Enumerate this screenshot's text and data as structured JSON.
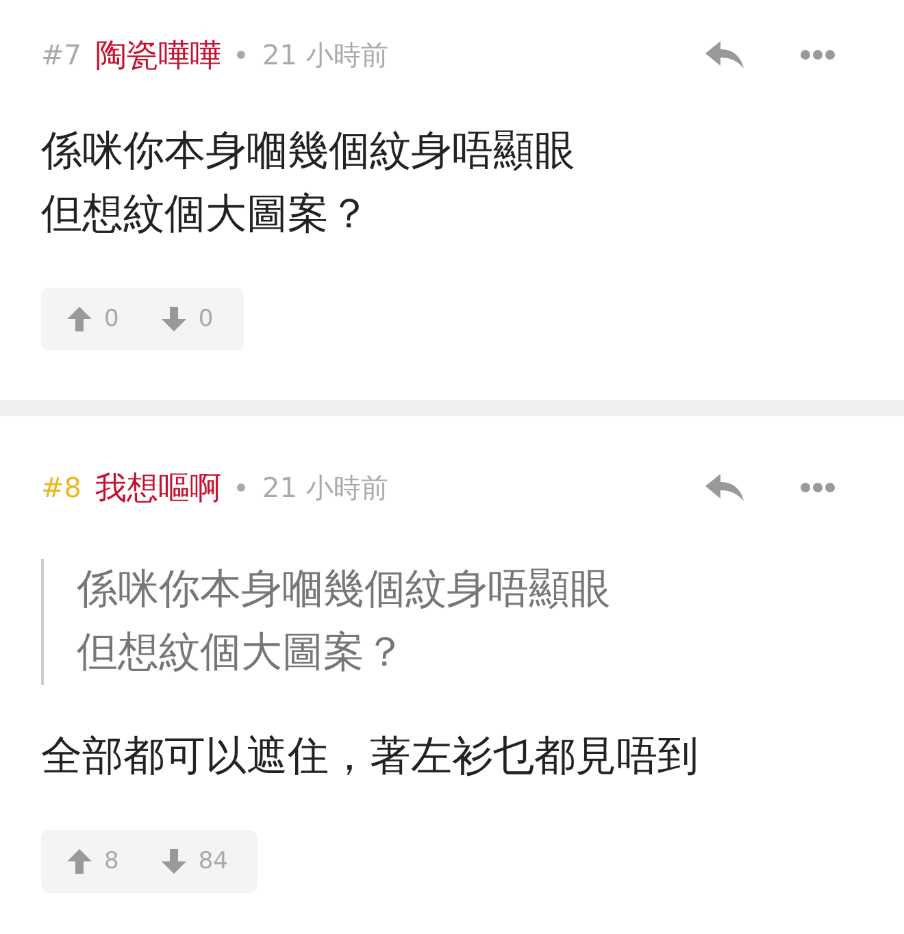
{
  "comments": [
    {
      "number": "#7",
      "color": "#aaaaaa",
      "author": "陶瓷嘩嘩",
      "time": "21 小時前",
      "body": [
        {
          "kind": "text",
          "lines": [
            "係咪你本身嗰幾個紋身唔顯眼",
            "但想紋個大圖案？"
          ]
        }
      ],
      "upvotes": "0",
      "downvotes": "0"
    },
    {
      "number": "#8",
      "color": "#e8b820",
      "author": "我想嘔啊",
      "time": "21 小時前",
      "body": [
        {
          "kind": "quote",
          "lines": [
            "係咪你本身嗰幾個紋身唔顯眼",
            "但想紋個大圖案？"
          ]
        },
        {
          "kind": "text",
          "lines": [
            "全部都可以遮住，著左衫乜都見唔到"
          ]
        }
      ],
      "upvotes": "8",
      "downvotes": "84"
    }
  ]
}
